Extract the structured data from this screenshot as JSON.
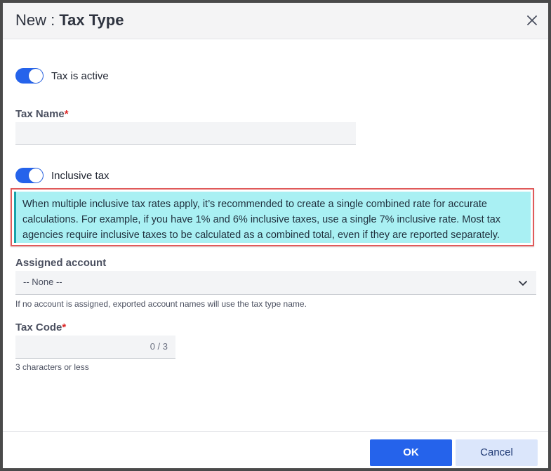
{
  "dialog": {
    "title_prefix": "New : ",
    "title_name": "Tax Type",
    "close_icon": "close-icon"
  },
  "form": {
    "tax_active": {
      "label": "Tax is active",
      "checked": true
    },
    "tax_name": {
      "label": "Tax Name",
      "required_mark": "*",
      "value": "",
      "placeholder": ""
    },
    "inclusive_tax": {
      "label": "Inclusive tax",
      "checked": true
    },
    "info_message": "When multiple inclusive tax rates apply, it’s recommended to create a single combined rate for accurate calculations. For example, if you have 1% and 6% inclusive taxes, use a single 7% inclusive rate. Most tax agencies require inclusive taxes to be calculated as a combined total, even if they are reported separately.",
    "assigned_account": {
      "label": "Assigned account",
      "selected": "-- None --",
      "help": "If no account is assigned, exported account names will use the tax type name."
    },
    "tax_code": {
      "label": "Tax Code",
      "required_mark": "*",
      "counter": "0 / 3",
      "help": "3 characters or less"
    }
  },
  "footer": {
    "ok_label": "OK",
    "cancel_label": "Cancel"
  },
  "colors": {
    "accent": "#2563eb",
    "info_background": "#a9f0f3",
    "required": "#dc2626",
    "highlight_border": "#e05a5a"
  }
}
